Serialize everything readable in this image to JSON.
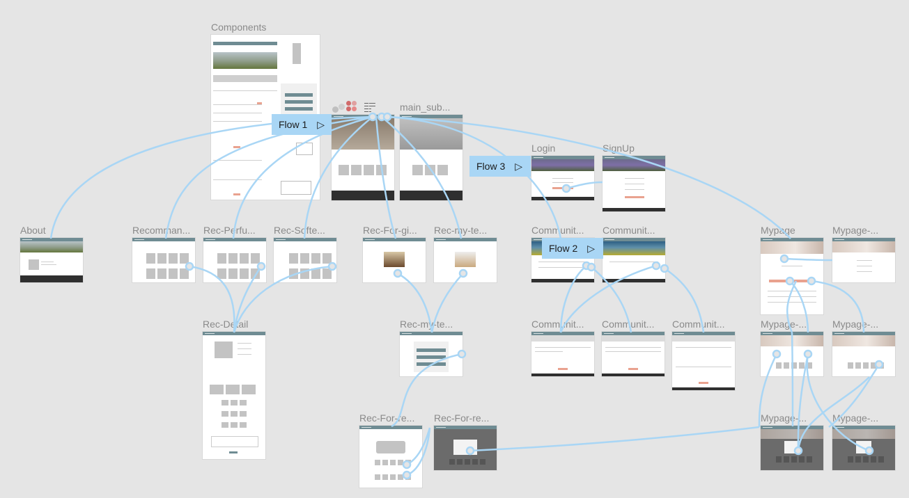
{
  "frames": {
    "components": "Components",
    "main_sub": "main_sub...",
    "login": "Login",
    "signup": "SignUp",
    "about": "About",
    "recomman": "Recomman...",
    "rec_perfu": "Rec-Perfu...",
    "rec_softe": "Rec-Softe...",
    "rec_for_gi": "Rec-For-gi...",
    "rec_my_te_top": "Rec-my-te...",
    "communit_1": "Communit...",
    "communit_2": "Communit...",
    "mypage": "Mypage",
    "mypage_2": "Mypage-...",
    "rec_detail": "Rec-Detail",
    "rec_my_te_mid": "Rec-my-te...",
    "communit_3": "Communit...",
    "communit_4": "Communit...",
    "communit_5": "Communit...",
    "mypage_3": "Mypage-...",
    "mypage_4": "Mypage-...",
    "rec_for_re_1": "Rec-For-re...",
    "rec_for_re_2": "Rec-For-re...",
    "mypage_5": "Mypage-...",
    "mypage_6": "Mypage-..."
  },
  "flows": {
    "flow1": "Flow 1",
    "flow2": "Flow 2",
    "flow3": "Flow 3"
  },
  "colors": {
    "canvas": "#e5e5e5",
    "connector": "#a9d6f5",
    "nav": "#6f8c93",
    "accent": "#e9a28f"
  },
  "icons": {
    "play": "▷"
  }
}
